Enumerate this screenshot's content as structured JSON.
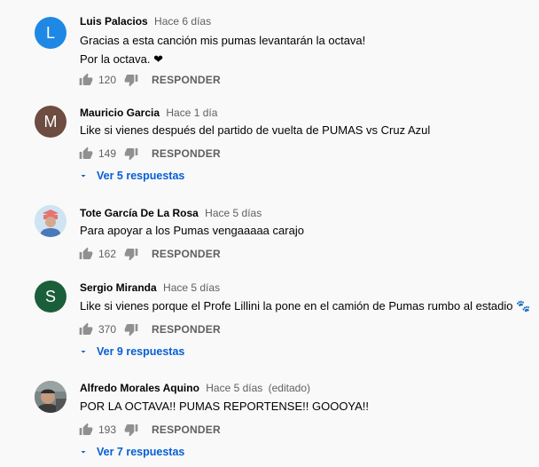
{
  "comments": [
    {
      "avatar_letter": "L",
      "avatar_color": "#1e88e5",
      "author": "Luis Palacios",
      "time": "Hace 6 días",
      "edited": "",
      "lines": [
        "Gracias a esta canción mis pumas levantarán la octava!",
        "Por la octava. ❤"
      ],
      "likes": "120",
      "reply_label": "RESPONDER",
      "replies_label": ""
    },
    {
      "avatar_letter": "M",
      "avatar_color": "#6d4c41",
      "author": "Mauricio Garcia",
      "time": "Hace 1 día",
      "edited": "",
      "lines": [
        "Like si vienes después del partido de vuelta de PUMAS vs Cruz Azul"
      ],
      "likes": "149",
      "reply_label": "RESPONDER",
      "replies_label": "Ver 5 respuestas"
    },
    {
      "avatar_letter": "",
      "avatar_color": "#cfe4f3",
      "author": "Tote García De La Rosa",
      "time": "Hace 5 días",
      "edited": "",
      "lines": [
        "Para apoyar a los Pumas vengaaaaa carajo"
      ],
      "likes": "162",
      "reply_label": "RESPONDER",
      "replies_label": ""
    },
    {
      "avatar_letter": "S",
      "avatar_color": "#1b5e3a",
      "author": "Sergio Miranda",
      "time": "Hace 5 días",
      "edited": "",
      "lines": [
        "Like si vienes porque el Profe Lillini la pone en el camión de Pumas rumbo al estadio 🐾"
      ],
      "likes": "370",
      "reply_label": "RESPONDER",
      "replies_label": "Ver 9 respuestas"
    },
    {
      "avatar_letter": "",
      "avatar_color": "#5f6a6a",
      "author": "Alfredo Morales Aquino",
      "time": "Hace 5 días",
      "edited": "(editado)",
      "lines": [
        "POR LA OCTAVA!! PUMAS REPORTENSE!! GOOOYA!!"
      ],
      "likes": "193",
      "reply_label": "RESPONDER",
      "replies_label": "Ver 7 respuestas"
    }
  ]
}
